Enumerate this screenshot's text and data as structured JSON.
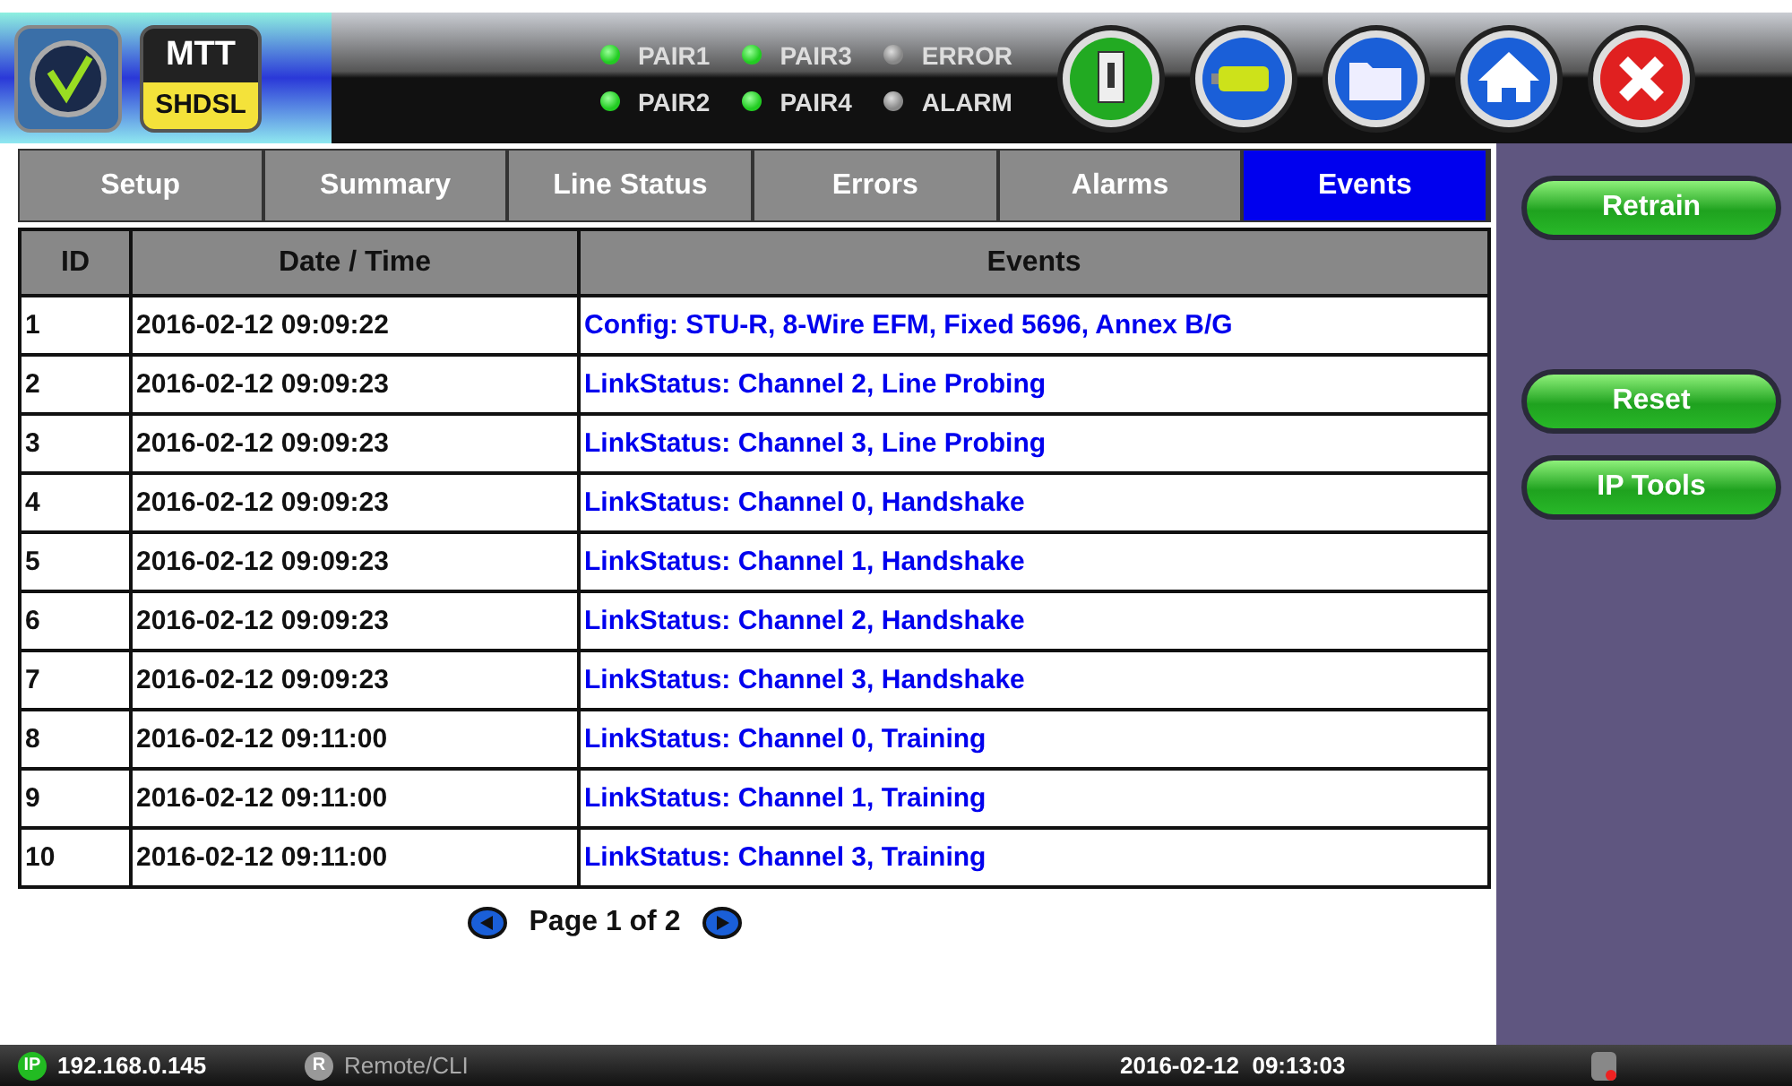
{
  "header": {
    "logo_top": "MTT",
    "logo_bottom": "SHDSL",
    "leds": [
      {
        "label": "PAIR1",
        "on": true
      },
      {
        "label": "PAIR2",
        "on": true
      },
      {
        "label": "PAIR3",
        "on": true
      },
      {
        "label": "PAIR4",
        "on": true
      },
      {
        "label": "ERROR",
        "on": false
      },
      {
        "label": "ALARM",
        "on": false
      }
    ]
  },
  "tabs": [
    {
      "label": "Setup",
      "selected": false
    },
    {
      "label": "Summary",
      "selected": false
    },
    {
      "label": "Line Status",
      "selected": false
    },
    {
      "label": "Errors",
      "selected": false
    },
    {
      "label": "Alarms",
      "selected": false
    },
    {
      "label": "Events",
      "selected": true
    }
  ],
  "table": {
    "columns": [
      "ID",
      "Date / Time",
      "Events"
    ],
    "rows": [
      [
        "1",
        "2016-02-12 09:09:22",
        "Config: STU-R, 8-Wire EFM, Fixed 5696, Annex B/G"
      ],
      [
        "2",
        "2016-02-12 09:09:23",
        "LinkStatus: Channel 2, Line Probing"
      ],
      [
        "3",
        "2016-02-12 09:09:23",
        "LinkStatus: Channel 3, Line Probing"
      ],
      [
        "4",
        "2016-02-12 09:09:23",
        "LinkStatus: Channel 0, Handshake"
      ],
      [
        "5",
        "2016-02-12 09:09:23",
        "LinkStatus: Channel 1, Handshake"
      ],
      [
        "6",
        "2016-02-12 09:09:23",
        "LinkStatus: Channel 2, Handshake"
      ],
      [
        "7",
        "2016-02-12 09:09:23",
        "LinkStatus: Channel 3, Handshake"
      ],
      [
        "8",
        "2016-02-12 09:11:00",
        "LinkStatus: Channel 0, Training"
      ],
      [
        "9",
        "2016-02-12 09:11:00",
        "LinkStatus: Channel 1, Training"
      ],
      [
        "10",
        "2016-02-12 09:11:00",
        "LinkStatus: Channel 3, Training"
      ]
    ]
  },
  "pagination": "Page 1 of 2",
  "side_buttons": [
    "Retrain",
    "Reset",
    "IP Tools"
  ],
  "status_bar": {
    "ip_badge": "IP",
    "ip": "192.168.0.145",
    "remote_badge": "R",
    "remote": "Remote/CLI",
    "datetime": "2016-02-12  09:13:03"
  }
}
